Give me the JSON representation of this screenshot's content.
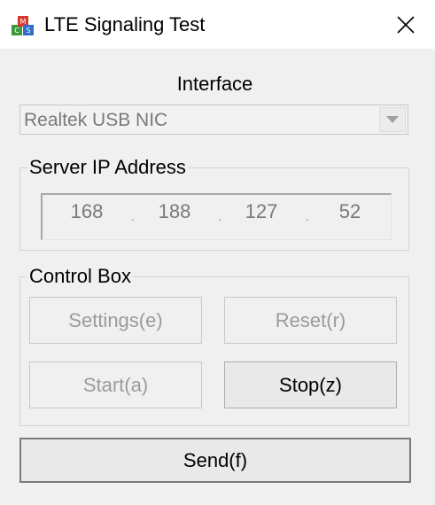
{
  "window": {
    "title": "LTE Signaling Test",
    "icon": "app-blocks-icon",
    "close_icon": "close-icon"
  },
  "interface": {
    "label": "Interface",
    "selected": "Realtek USB NIC"
  },
  "server": {
    "group_title": "Server IP Address",
    "ip": [
      "168",
      "188",
      "127",
      "52"
    ],
    "separator": "."
  },
  "control": {
    "group_title": "Control Box",
    "settings_label": "Settings(e)",
    "reset_label": "Reset(r)",
    "start_label": "Start(a)",
    "stop_label": "Stop(z)"
  },
  "send_label": "Send(f)",
  "colors": {
    "disabled_text": "#9b9b9b",
    "border": "#d3d3d3"
  }
}
